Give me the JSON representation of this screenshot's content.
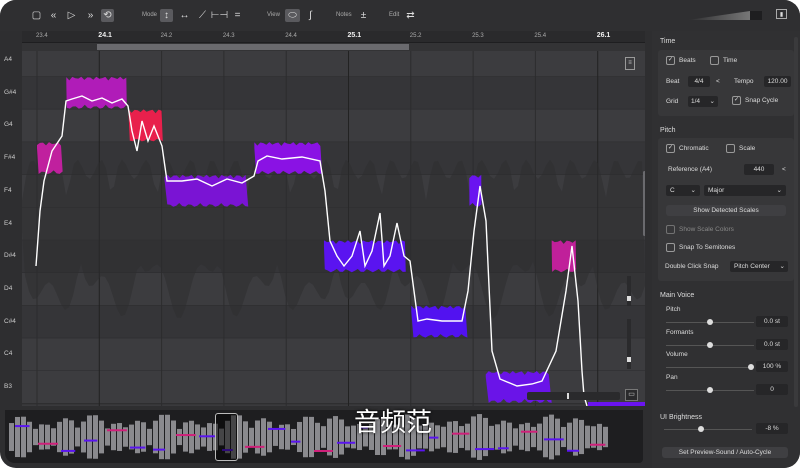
{
  "toolbar": {
    "mode_label": "Mode",
    "view_label": "View",
    "notes_label": "Notes",
    "edit_label": "Edit",
    "notes_plus": "±"
  },
  "ruler": {
    "ticks": [
      {
        "label": "23.4",
        "bold": false
      },
      {
        "label": "24.1",
        "bold": true
      },
      {
        "label": "24.2",
        "bold": false
      },
      {
        "label": "24.3",
        "bold": false
      },
      {
        "label": "24.4",
        "bold": false
      },
      {
        "label": "25.1",
        "bold": true
      },
      {
        "label": "25.2",
        "bold": false
      },
      {
        "label": "25.3",
        "bold": false
      },
      {
        "label": "25.4",
        "bold": false
      },
      {
        "label": "26.1",
        "bold": true
      }
    ]
  },
  "keys": [
    "A4",
    "G#4",
    "G4",
    "F#4",
    "F4",
    "E4",
    "D#4",
    "D4",
    "C#4",
    "C4",
    "B3"
  ],
  "notes": [
    {
      "pitch": "F#4",
      "start": 0,
      "end": 0.42,
      "color": "#c0209e"
    },
    {
      "pitch": "G#4",
      "start": 0.48,
      "end": 1.47,
      "color": "#b01cb8"
    },
    {
      "pitch": "G4",
      "start": 1.5,
      "end": 2.06,
      "color": "#e8204c"
    },
    {
      "pitch": "F4",
      "start": 2.09,
      "end": 3.46,
      "color": "#7a14d4"
    },
    {
      "pitch": "F#4",
      "start": 3.56,
      "end": 4.67,
      "color": "#8a12e4"
    },
    {
      "pitch": "D#4",
      "start": 4.7,
      "end": 6.04,
      "color": "#5a14f0"
    },
    {
      "pitch": "C#4",
      "start": 6.13,
      "end": 7.05,
      "color": "#5212f0"
    },
    {
      "pitch": "F4",
      "start": 7.08,
      "end": 7.28,
      "color": "#6a14f0"
    },
    {
      "pitch": "B3",
      "start": 7.35,
      "end": 8.43,
      "color": "#6a14e8"
    },
    {
      "pitch": "D#4",
      "start": 8.43,
      "end": 8.83,
      "color": "#c0209a"
    }
  ],
  "side": {
    "time": {
      "title": "Time",
      "beats": "Beats",
      "time": "Time",
      "beat_label": "Beat",
      "beat_value": "4/4",
      "tempo_label": "Tempo",
      "tempo_value": "120.00",
      "grid_label": "Grid",
      "grid_value": "1/4",
      "snap_cycle": "Snap Cycle",
      "arrow": "<"
    },
    "pitch": {
      "title": "Pitch",
      "chromatic": "Chromatic",
      "scale": "Scale",
      "reference_label": "Reference (A4)",
      "reference_value": "440",
      "key": "C",
      "mode": "Major",
      "show_detected": "Show Detected Scales",
      "show_scale_colors": "Show Scale Colors",
      "snap_semitones": "Snap To Semitones",
      "dbl_label": "Double Click Snap",
      "dbl_value": "Pitch Center",
      "arrow": "<"
    },
    "voice": {
      "title": "Main Voice",
      "pitch_label": "Pitch",
      "pitch_value": "0.0 st",
      "pitch_pos": 0.5,
      "formants_label": "Formants",
      "formants_value": "0.0 st",
      "formants_pos": 0.5,
      "volume_label": "Volume",
      "volume_value": "100 %",
      "volume_pos": 1.0,
      "pan_label": "Pan",
      "pan_value": "0",
      "pan_pos": 0.5
    },
    "brightness": {
      "label": "UI Brightness",
      "value": "-8 %",
      "pos": 0.42
    },
    "preview_button": "Set Preview-Sound / Auto-Cycle"
  },
  "watermark": "音频范",
  "colors": {
    "accent": "#7a14d4"
  }
}
